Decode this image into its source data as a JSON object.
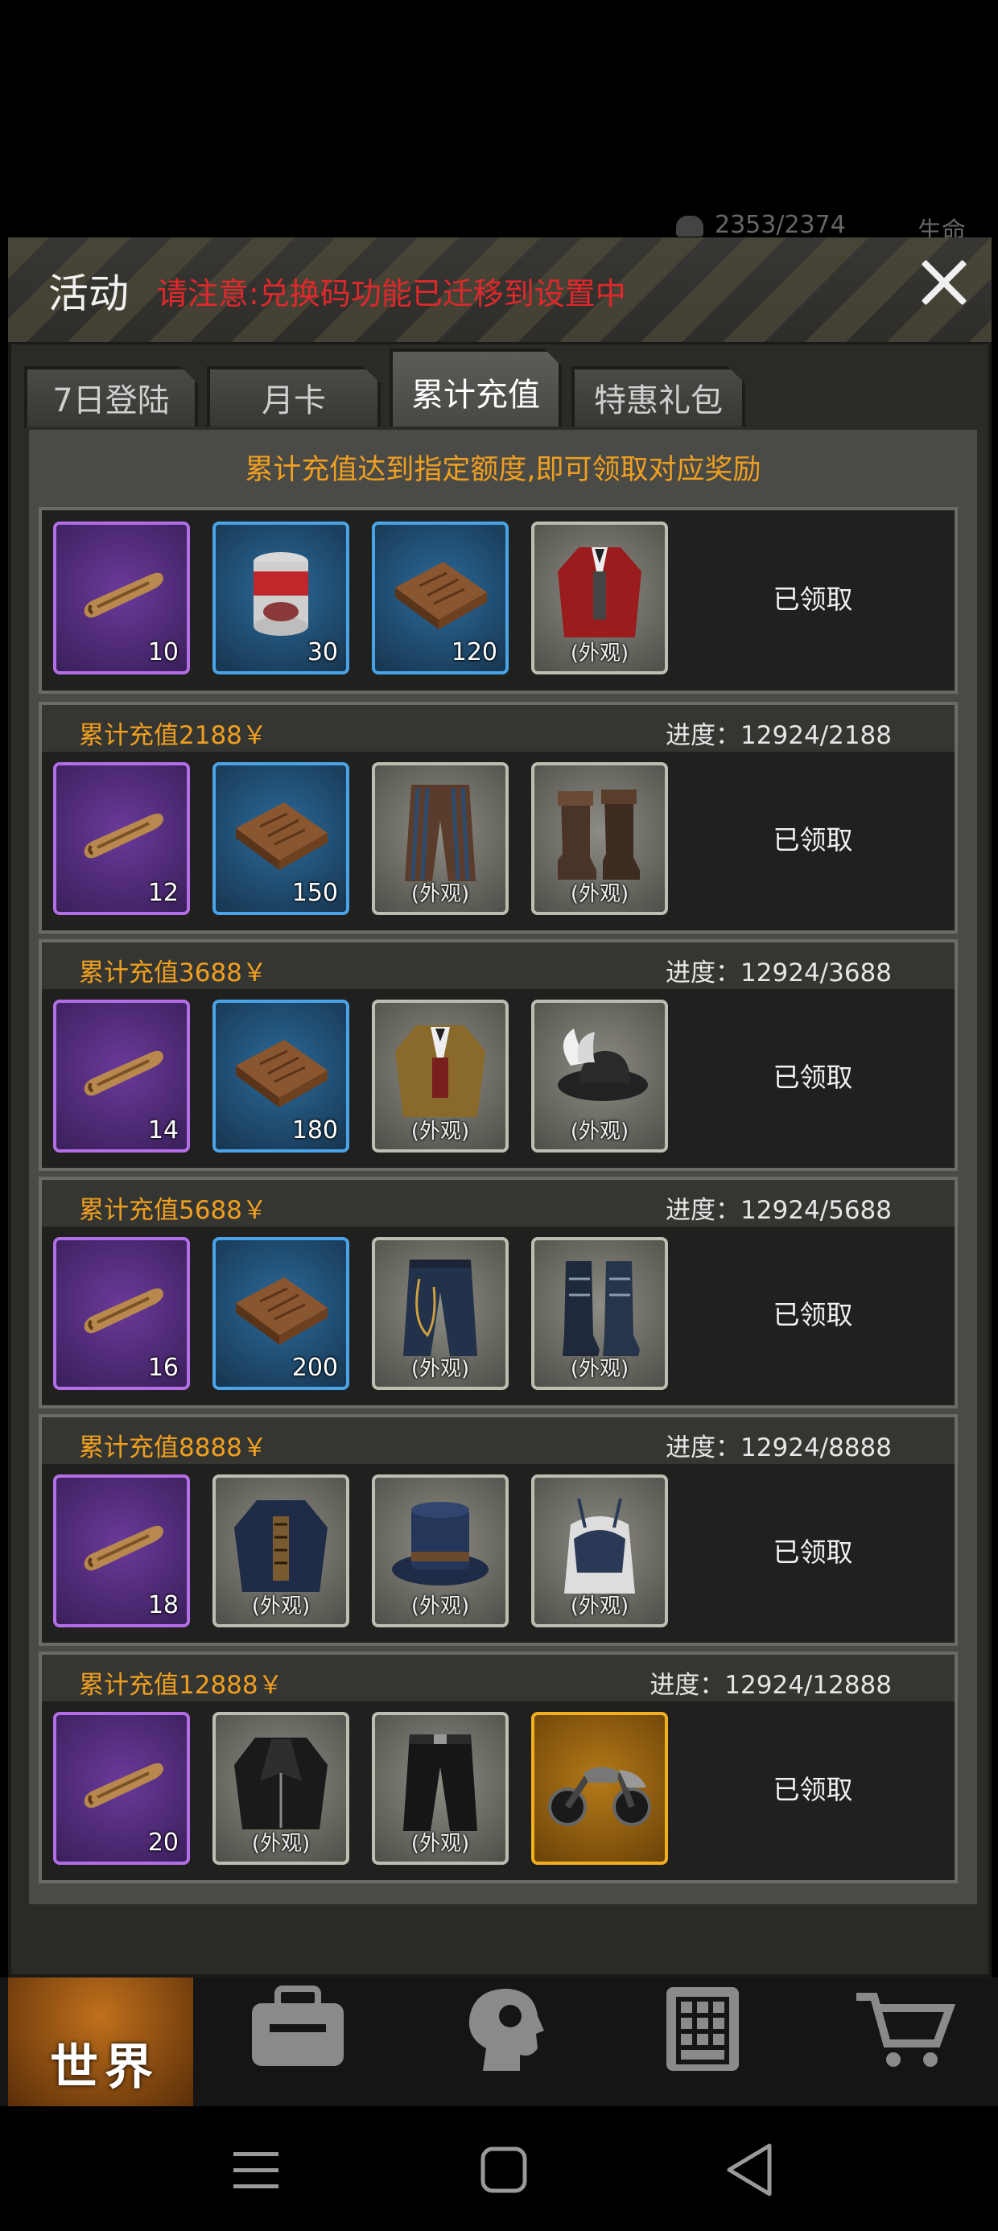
{
  "status": {
    "supply": "2353/2374",
    "life_label": "生命"
  },
  "modal": {
    "title": "活动",
    "notice": "请注意:兑换码功能已迁移到设置中"
  },
  "tabs": [
    {
      "label": "7日登陆",
      "active": false
    },
    {
      "label": "月卡",
      "active": false
    },
    {
      "label": "累计充值",
      "active": true
    },
    {
      "label": "特惠礼包",
      "active": false
    }
  ],
  "info_text": "累计充值达到指定额度,即可领取对应奖励",
  "skin_label": "(外观)",
  "rows": [
    {
      "title": "",
      "progress": "",
      "claimed": "已领取",
      "rewards": [
        {
          "icon": "cigar-icon",
          "rarity": "purple",
          "count": "10"
        },
        {
          "icon": "meat-can-icon",
          "rarity": "blue",
          "count": "30"
        },
        {
          "icon": "blueprint-book-icon",
          "rarity": "blue",
          "count": "120"
        },
        {
          "icon": "red-coat-icon",
          "rarity": "gray",
          "count": "",
          "skin": true
        }
      ]
    },
    {
      "title": "累计充值2188￥",
      "progress": "进度：12924/2188",
      "claimed": "已领取",
      "rewards": [
        {
          "icon": "cigar-icon",
          "rarity": "purple",
          "count": "12"
        },
        {
          "icon": "blueprint-book-icon",
          "rarity": "blue",
          "count": "150"
        },
        {
          "icon": "striped-pants-icon",
          "rarity": "gray",
          "count": "",
          "skin": true
        },
        {
          "icon": "leather-boots-icon",
          "rarity": "gray",
          "count": "",
          "skin": true
        }
      ]
    },
    {
      "title": "累计充值3688￥",
      "progress": "进度：12924/3688",
      "claimed": "已领取",
      "rewards": [
        {
          "icon": "cigar-icon",
          "rarity": "purple",
          "count": "14"
        },
        {
          "icon": "blueprint-book-icon",
          "rarity": "blue",
          "count": "180"
        },
        {
          "icon": "brown-jacket-icon",
          "rarity": "gray",
          "count": "",
          "skin": true
        },
        {
          "icon": "feathered-hat-icon",
          "rarity": "gray",
          "count": "",
          "skin": true
        }
      ]
    },
    {
      "title": "累计充值5688￥",
      "progress": "进度：12924/5688",
      "claimed": "已领取",
      "rewards": [
        {
          "icon": "cigar-icon",
          "rarity": "purple",
          "count": "16"
        },
        {
          "icon": "blueprint-book-icon",
          "rarity": "blue",
          "count": "200"
        },
        {
          "icon": "chain-jeans-icon",
          "rarity": "gray",
          "count": "",
          "skin": true
        },
        {
          "icon": "tall-boots-icon",
          "rarity": "gray",
          "count": "",
          "skin": true
        }
      ]
    },
    {
      "title": "累计充值8888￥",
      "progress": "进度：12924/8888",
      "claimed": "已领取",
      "rewards": [
        {
          "icon": "cigar-icon",
          "rarity": "purple",
          "count": "18"
        },
        {
          "icon": "blue-coat-icon",
          "rarity": "gray",
          "count": "",
          "skin": true
        },
        {
          "icon": "top-hat-icon",
          "rarity": "gray",
          "count": "",
          "skin": true
        },
        {
          "icon": "corset-top-icon",
          "rarity": "gray",
          "count": "",
          "skin": true
        }
      ]
    },
    {
      "title": "累计充值12888￥",
      "progress": "进度：12924/12888",
      "claimed": "已领取",
      "rewards": [
        {
          "icon": "cigar-icon",
          "rarity": "purple",
          "count": "20"
        },
        {
          "icon": "leather-jacket-icon",
          "rarity": "gray",
          "count": "",
          "skin": true
        },
        {
          "icon": "leather-pants-icon",
          "rarity": "gray",
          "count": "",
          "skin": true
        },
        {
          "icon": "motorcycle-icon",
          "rarity": "gold",
          "count": ""
        }
      ]
    }
  ],
  "bottom_nav": {
    "world_label": "世界"
  },
  "colors": {
    "accent": "#f0a020",
    "notice": "#e0282c",
    "purple": "#b36ee6",
    "blue": "#4aa3e6",
    "gold": "#f0b020"
  }
}
